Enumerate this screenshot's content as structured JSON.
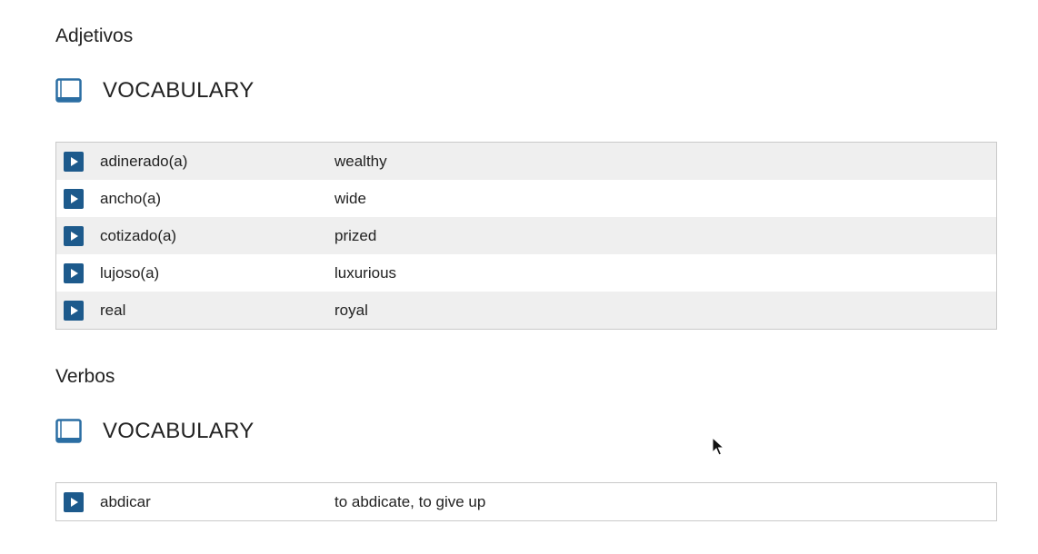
{
  "sections": [
    {
      "title": "Adjetivos",
      "vocab_label": "VOCABULARY",
      "entries": [
        {
          "term": "adinerado(a)",
          "meaning": "wealthy"
        },
        {
          "term": "ancho(a)",
          "meaning": "wide"
        },
        {
          "term": "cotizado(a)",
          "meaning": "prized"
        },
        {
          "term": "lujoso(a)",
          "meaning": "luxurious"
        },
        {
          "term": "real",
          "meaning": "royal"
        }
      ]
    },
    {
      "title": "Verbos",
      "vocab_label": "VOCABULARY",
      "entries": [
        {
          "term": "abdicar",
          "meaning": "to abdicate, to give up"
        }
      ]
    }
  ],
  "icons": {
    "book": "book-icon",
    "play": "play-icon",
    "cursor": "mouse-pointer-icon"
  },
  "colors": {
    "play_button": "#1d5a8c",
    "book_icon": "#2b6ea3",
    "alt_row": "#efefef",
    "table_border": "#c9c9c9"
  }
}
